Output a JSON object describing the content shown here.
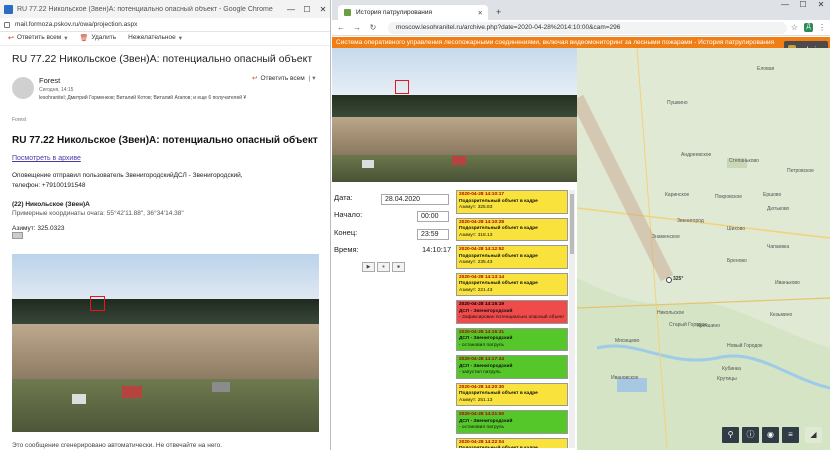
{
  "left_window": {
    "title": "RU 77.22 Никольское (Звен)А: потенциально опасный объект - Google Chrome",
    "url": "mail.formoza.pskov.ru/owa/projection.aspx",
    "toolbar": [
      {
        "label": "Ответить всем",
        "icon": "reply-all-icon",
        "has_caret": true
      },
      {
        "label": "Удалить",
        "icon": "trash-icon",
        "has_caret": false
      },
      {
        "label": "Нежелательное",
        "icon": "",
        "has_caret": true
      }
    ],
    "subject": "RU 77.22 Никольское (Звен)А: потенциально опасный объект",
    "sender": {
      "name": "Forest",
      "date": "Сегодня, 14:15",
      "to": "lesohranitel; Дмитрий Горменков; Виталий Котов; Виталий Агапов; и еще 6 получателей ¥"
    },
    "reply_all_label": "Ответить всем",
    "folder_label": "Forest",
    "body": {
      "heading": "RU 77.22 Никольское (Звен)А: потенциально опасный объект",
      "archive_link": "Посмотреть в архиве",
      "notice_line1": "Оповещение отправил пользователь ЗвенигородскийДСЛ - Звенигородский,",
      "notice_line2": "телефон: +79100191548",
      "camera_line": "(22) Никольское (Звен)А",
      "coords_line": "Примерные координаты очага: 55°42'11.88\", 36°34'14.38\"",
      "azimuth_line": "Азимут: 325.0323",
      "footer": "Это сообщение сгенерировано автоматически. Не отвечайте на него."
    }
  },
  "right_window": {
    "tab_title": "История патрулирования",
    "url": "moscow.lesohranitel.ru/archive.php?date=2020-04-28%2014:10:00&cam=296",
    "profile_initial": "Д",
    "banner": "Система оперативного управления лесопожарными соединениями, включая видеомониторинг за лесными пожарами - История патрулирования",
    "admin_label": "admin",
    "form": {
      "date_label": "Дата:",
      "date_value": "28.04.2020",
      "start_label": "Начало:",
      "start_value": "00:00",
      "end_label": "Конец:",
      "end_value": "23:59",
      "time_label": "Время:",
      "time_value": "14:10:17"
    },
    "controls": [
      "▶",
      "⏸",
      "⏹"
    ],
    "events": [
      {
        "color": "yellow",
        "datetime": "2020-04-28 14:10:17",
        "title": "Подозрительный объект в кадре",
        "detail": "Азимут: 325.83"
      },
      {
        "color": "yellow",
        "datetime": "2020-04-28 14:10:28",
        "title": "Подозрительный объект в кадре",
        "detail": "Азимут: 318.13"
      },
      {
        "color": "yellow",
        "datetime": "2020-04-28 14:12:52",
        "title": "Подозрительный объект в кадре",
        "detail": "Азимут: 235.43"
      },
      {
        "color": "yellow",
        "datetime": "2020-04-28 14:13:14",
        "title": "Подозрительный объект в кадре",
        "detail": "Азимут: 221.43"
      },
      {
        "color": "red",
        "datetime": "2020-04-28 14:15:19",
        "title": "ДСЛ - Звенигородский",
        "detail": "- Зафиксирован потенциально опасный объект"
      },
      {
        "color": "green",
        "datetime": "2020-04-28 14:15:31",
        "title": "ДСЛ - Звенигородский",
        "detail": "- остановил патруль"
      },
      {
        "color": "green",
        "datetime": "2020-04-28 14:17:34",
        "title": "ДСЛ - Звенигородский",
        "detail": "- запустил патруль"
      },
      {
        "color": "yellow",
        "datetime": "2020-04-28 14:20:30",
        "title": "Подозрительный объект в кадре",
        "detail": "Азимут: 251.13"
      },
      {
        "color": "green",
        "datetime": "2020-04-28 14:21:50",
        "title": "ДСЛ - Звенигородский",
        "detail": "- остановил патруль"
      },
      {
        "color": "yellow",
        "datetime": "2020-04-28 14:22:04",
        "title": "Подозрительный объект в кадре",
        "detail": "Азимут: 228.93"
      }
    ],
    "map": {
      "labels": [
        {
          "text": "Пушкино"
        },
        {
          "text": "Еловая"
        },
        {
          "text": "Андреевское"
        },
        {
          "text": "Степаньково"
        },
        {
          "text": "Каринское"
        },
        {
          "text": "Покровское"
        },
        {
          "text": "Ершово"
        },
        {
          "text": "Дютьково"
        },
        {
          "text": "Звенигород"
        },
        {
          "text": "Знаменское"
        },
        {
          "text": "Шихово"
        },
        {
          "text": "Иваньково"
        },
        {
          "text": "Кезьмино"
        },
        {
          "text": "Крекшино"
        },
        {
          "text": "Никольское"
        },
        {
          "text": "Старый Городок"
        },
        {
          "text": "Новый Городок"
        },
        {
          "text": "Мясищево"
        },
        {
          "text": "Кубинка"
        },
        {
          "text": "Бреново"
        },
        {
          "text": "Крутицы"
        },
        {
          "text": "Ивановское"
        },
        {
          "text": "Чапаевка"
        },
        {
          "text": "Петровское"
        }
      ],
      "azimuth_label": "325°",
      "controls": [
        "search-icon",
        "info-icon",
        "camera-icon",
        "layers-icon",
        "triangle-icon"
      ]
    }
  }
}
